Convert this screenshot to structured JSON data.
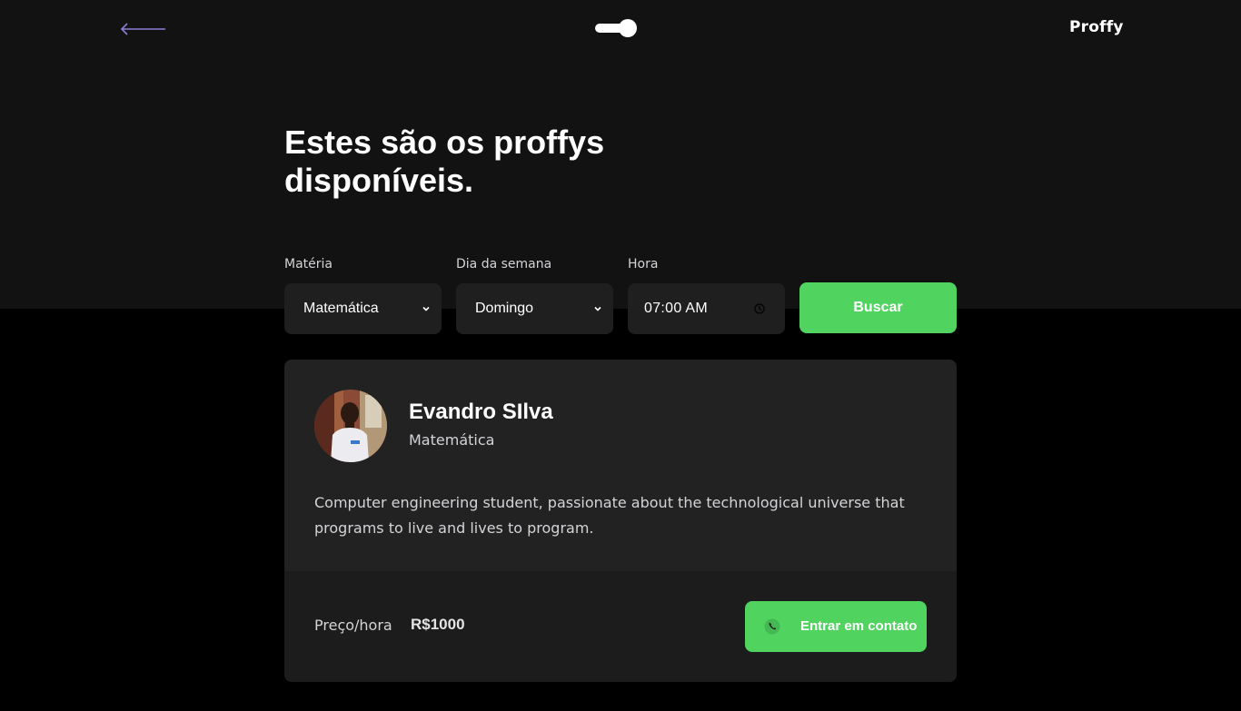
{
  "header": {
    "logo": "Proffy",
    "back_icon": "arrow-left-icon",
    "theme_toggle_icon": "toggle-switch-icon"
  },
  "page": {
    "title_line1": "Estes são os proffys",
    "title_line2": "disponíveis."
  },
  "filters": {
    "subject": {
      "label": "Matéria",
      "value": "Matemática"
    },
    "weekday": {
      "label": "Dia da semana",
      "value": "Domingo"
    },
    "time": {
      "label": "Hora",
      "value": "07:00 AM"
    },
    "search_label": "Buscar"
  },
  "teachers": [
    {
      "name": "Evandro SIlva",
      "subject": "Matemática",
      "bio": "Computer engineering student, passionate about the technological universe that programs to live and lives to program.",
      "price_label": "Preço/hora",
      "price": "R$1000",
      "contact_label": "Entrar em contato",
      "contact_icon": "whatsapp-icon"
    }
  ],
  "colors": {
    "background": "#000000",
    "header_bg": "#121212",
    "card_bg": "#222222",
    "card_footer_bg": "#1c1c1c",
    "accent_green": "#51d360",
    "back_arrow": "#8d7cd6"
  }
}
